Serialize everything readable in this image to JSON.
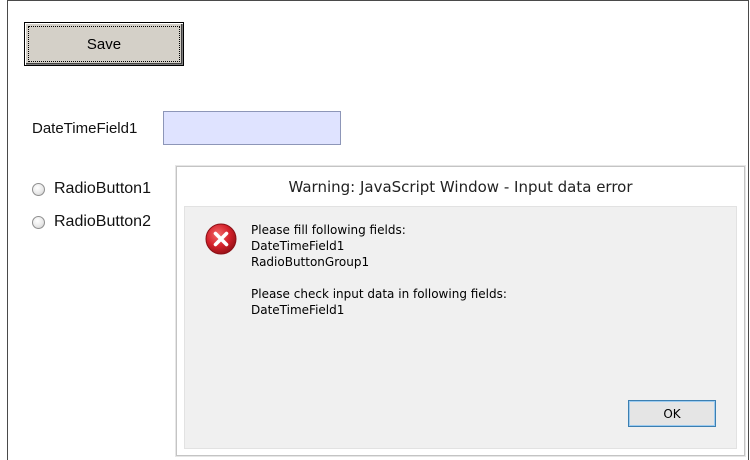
{
  "form": {
    "save_label": "Save",
    "datetime_label": "DateTimeField1",
    "datetime_value": "",
    "radio_options": [
      "RadioButton1",
      "RadioButton2"
    ]
  },
  "dialog": {
    "title": "Warning: JavaScript Window - Input data error",
    "icon": "error-icon",
    "fill_heading": "Please fill following fields:",
    "fill_fields": [
      "DateTimeField1",
      "RadioButtonGroup1"
    ],
    "check_heading": "Please check input data in following fields:",
    "check_fields": [
      "DateTimeField1"
    ],
    "ok_label": "OK"
  },
  "colors": {
    "input_bg": "#dfe3ff",
    "error_red": "#d4212b",
    "ok_border": "#3c7fb1"
  }
}
